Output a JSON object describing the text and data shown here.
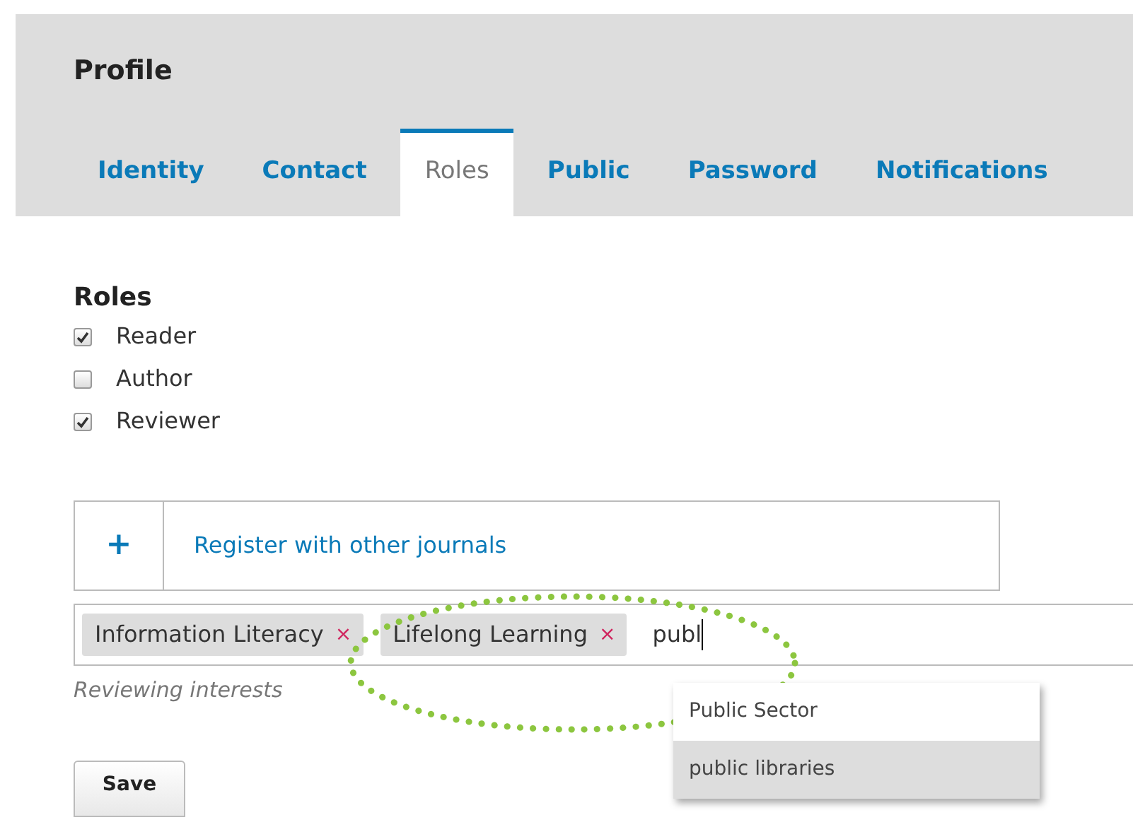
{
  "page": {
    "title": "Profile"
  },
  "tabs": [
    {
      "label": "Identity",
      "selected": false
    },
    {
      "label": "Contact",
      "selected": false
    },
    {
      "label": "Roles",
      "selected": true
    },
    {
      "label": "Public",
      "selected": false
    },
    {
      "label": "Password",
      "selected": false
    },
    {
      "label": "Notifications",
      "selected": false
    }
  ],
  "roles": {
    "heading": "Roles",
    "items": [
      {
        "label": "Reader",
        "checked": true
      },
      {
        "label": "Author",
        "checked": false
      },
      {
        "label": "Reviewer",
        "checked": true
      }
    ]
  },
  "register": {
    "icon": "+",
    "label": "Register with other journals"
  },
  "interests": {
    "tags": [
      {
        "label": "Information Literacy",
        "remove": "×"
      },
      {
        "label": "Lifelong Learning",
        "remove": "×"
      }
    ],
    "value": "publ",
    "hint": "Reviewing interests",
    "suggestions": [
      {
        "label": "Public Sector",
        "selected": false
      },
      {
        "label": "public libraries",
        "selected": true
      }
    ]
  },
  "save_button": "Save"
}
